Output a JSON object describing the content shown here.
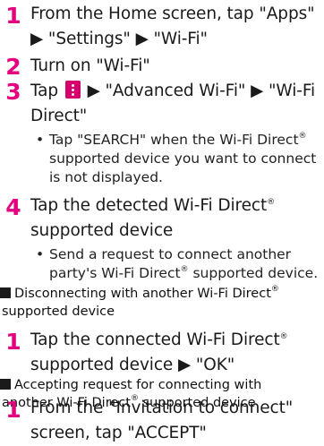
{
  "steps": [
    {
      "num": "1",
      "line1": "From the Home screen, tap \"Apps\"",
      "line2": "▶ \"Settings\" ▶ \"Wi-Fi\""
    },
    {
      "num": "2",
      "line1": "Turn on \"Wi-Fi\""
    },
    {
      "num": "3",
      "pre": "Tap",
      "post": "▶ \"Advanced Wi-Fi\" ▶ \"Wi-Fi",
      "line2": "Direct\"",
      "icon": "menu-icon"
    },
    {
      "num": "4",
      "line1": "Tap the detected Wi-Fi Direct",
      "line2": "supported device"
    },
    {
      "num": "1",
      "line1": "Tap the connected Wi-Fi Direct",
      "line2": "supported device ▶ \"OK\""
    },
    {
      "num": "1",
      "line1": "From the \"Invitation to connect\"",
      "line2": "screen, tap \"ACCEPT\""
    }
  ],
  "notes": [
    {
      "bullet": "•",
      "a": "Tap \"SEARCH\" when the Wi-Fi Direct",
      "b": " supported device you want to connect is not displayed."
    },
    {
      "bullet": "•",
      "a": "Send a request to connect another party's Wi-Fi Direct",
      "b": " supported device."
    }
  ],
  "headings": [
    {
      "a": "Disconnecting with another Wi-Fi Direct",
      "b": "supported device"
    },
    {
      "a": "Accepting request for connecting with",
      "b": "another Wi-Fi Direct",
      "c": " supported device"
    }
  ],
  "reg": "®",
  "colors": {
    "accent": "#e4007f",
    "text": "#1a1a1a"
  }
}
